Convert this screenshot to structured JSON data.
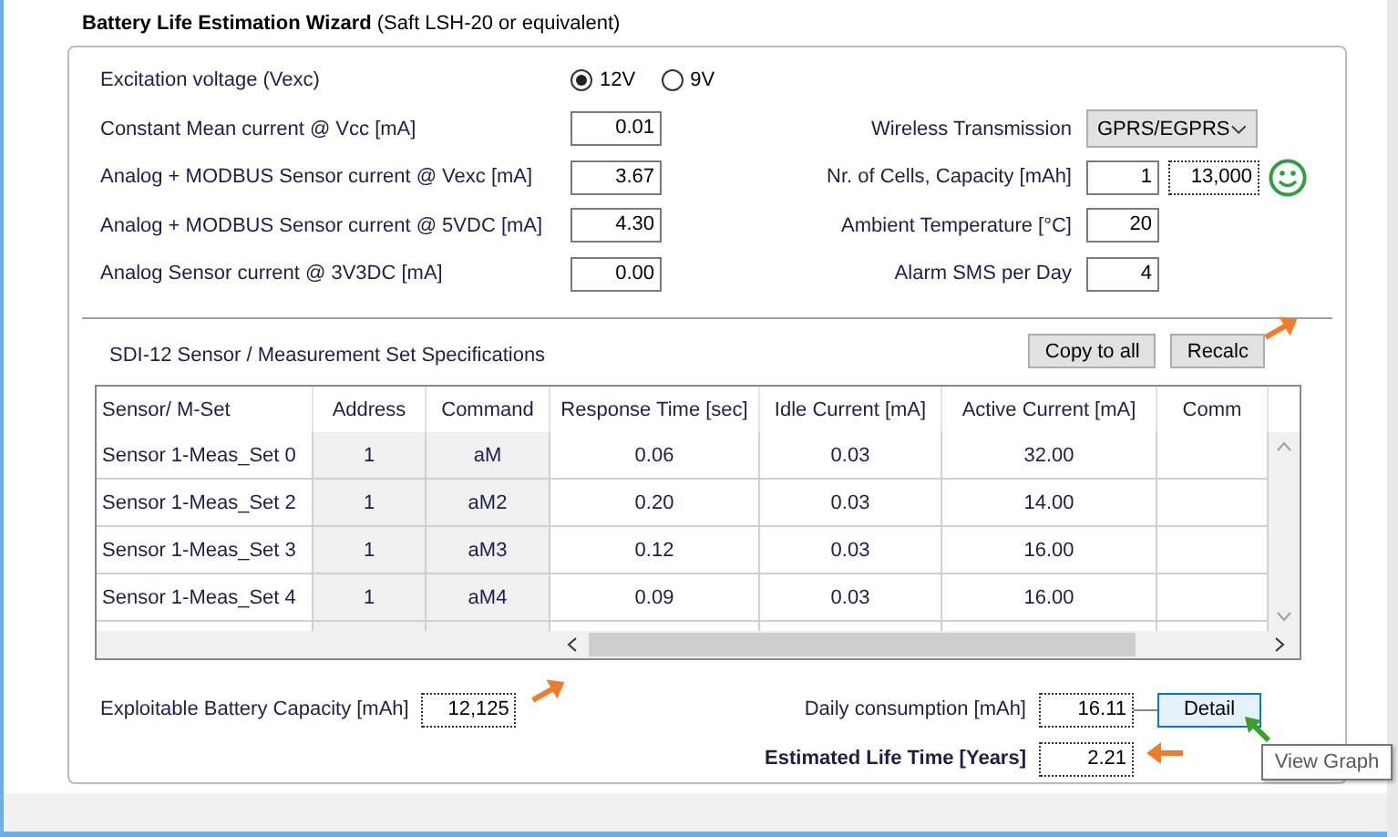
{
  "title": {
    "main": "Battery Life Estimation Wizard",
    "sub": "(Saft LSH-20 or equivalent)"
  },
  "excitation": {
    "label": "Excitation voltage (Vexc)",
    "options": [
      {
        "label": "12V",
        "selected": true
      },
      {
        "label": "9V",
        "selected": false
      }
    ]
  },
  "left_fields": [
    {
      "label": "Constant Mean current @ Vcc [mA]",
      "value": "0.01"
    },
    {
      "label": "Analog + MODBUS Sensor current @ Vexc [mA]",
      "value": "3.67"
    },
    {
      "label": "Analog + MODBUS Sensor current @ 5VDC [mA]",
      "value": "4.30"
    },
    {
      "label": "Analog Sensor current @ 3V3DC [mA]",
      "value": "0.00"
    }
  ],
  "right_fields": [
    {
      "kind": "dropdown",
      "label": "Wireless Transmission",
      "value": "GPRS/EGPRS"
    },
    {
      "kind": "pair",
      "label": "Nr. of Cells, Capacity [mAh]",
      "values": [
        {
          "value": "1",
          "focused": false
        },
        {
          "value": "13,000",
          "focused": true
        }
      ]
    },
    {
      "kind": "input",
      "label": "Ambient Temperature [°C]",
      "value": "20"
    },
    {
      "kind": "input",
      "label": "Alarm SMS per Day",
      "value": "4"
    }
  ],
  "sdi": {
    "title": "SDI-12 Sensor / Measurement Set Specifications",
    "buttons": [
      "Copy to all",
      "Recalc"
    ],
    "columns": [
      "Sensor/ M-Set",
      "Address",
      "Command",
      "Response Time [sec]",
      "Idle Current [mA]",
      "Active Current [mA]",
      "Comm"
    ],
    "rows": [
      [
        "Sensor 1-Meas_Set 0",
        "1",
        "aM",
        "0.06",
        "0.03",
        "32.00",
        ""
      ],
      [
        "Sensor 1-Meas_Set 2",
        "1",
        "aM2",
        "0.20",
        "0.03",
        "14.00",
        ""
      ],
      [
        "Sensor 1-Meas_Set 3",
        "1",
        "aM3",
        "0.12",
        "0.03",
        "16.00",
        ""
      ],
      [
        "Sensor 1-Meas_Set 4",
        "1",
        "aM4",
        "0.09",
        "0.03",
        "16.00",
        ""
      ]
    ]
  },
  "results": {
    "capacity_label": "Exploitable Battery Capacity [mAh]",
    "capacity": "12,125",
    "daily_label": "Daily consumption [mAh]",
    "daily": "16.11",
    "life_label": "Estimated Life Time [Years]",
    "life": "2.21",
    "detail_button": "Detail"
  },
  "tooltip": "View Graph"
}
